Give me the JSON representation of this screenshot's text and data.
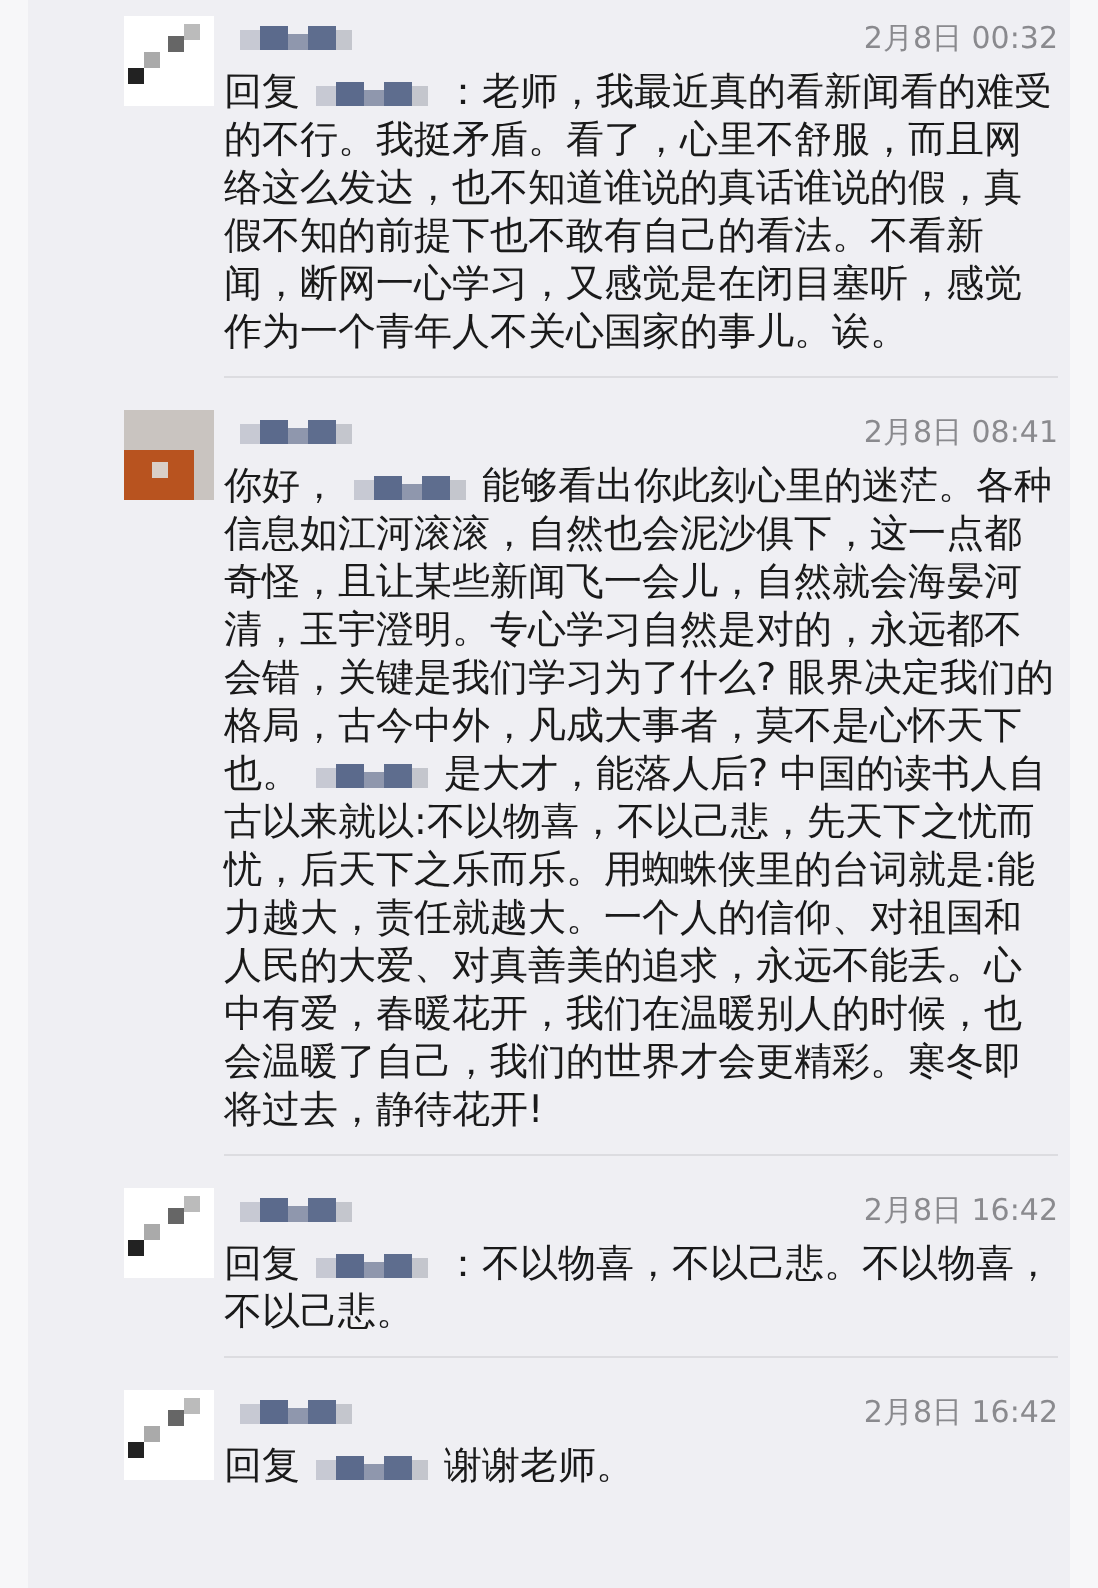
{
  "comments": [
    {
      "time": "2月8日 00:32",
      "avatar": {
        "kind": "plain"
      },
      "body": [
        {
          "kind": "text",
          "text": "回复"
        },
        {
          "kind": "redacted"
        },
        {
          "kind": "text",
          "text": "：老师，我最近真的看新闻看的难受的不行。我挺矛盾。看了，心里不舒服，而且网络这么发达，也不知道谁说的真话谁说的假，真假不知的前提下也不敢有自己的看法。不看新闻，断网一心学习，又感觉是在闭目塞听，感觉作为一个青年人不关心国家的事儿。诶。"
        }
      ]
    },
    {
      "time": "2月8日 08:41",
      "avatar": {
        "kind": "brown"
      },
      "body": [
        {
          "kind": "text",
          "text": "你好，"
        },
        {
          "kind": "redacted"
        },
        {
          "kind": "text",
          "text": "能够看出你此刻心里的迷茫。各种信息如江河滚滚，自然也会泥沙俱下，这一点都奇怪，且让某些新闻飞一会儿，自然就会海晏河清，玉宇澄明。专心学习自然是对的，永远都不会错，关键是我们学习为了什么? 眼界决定我们的格局，古今中外，凡成大事者，莫不是心怀天下也。"
        },
        {
          "kind": "redacted"
        },
        {
          "kind": "text",
          "text": "是大才，能落人后? 中国的读书人自古以来就以:不以物喜，不以己悲，先天下之忧而忧，后天下之乐而乐。用蜘蛛侠里的台词就是:能力越大，责任就越大。一个人的信仰、对祖国和人民的大爱、对真善美的追求，永远不能丢。心中有爱，春暖花开，我们在温暖别人的时候，也会温暖了自己，我们的世界才会更精彩。寒冬即将过去，静待花开!"
        }
      ]
    },
    {
      "time": "2月8日 16:42",
      "avatar": {
        "kind": "plain"
      },
      "body": [
        {
          "kind": "text",
          "text": "回复"
        },
        {
          "kind": "redacted"
        },
        {
          "kind": "text",
          "text": "：不以物喜，不以己悲。不以物喜，不以己悲。"
        }
      ]
    },
    {
      "time": "2月8日 16:42",
      "avatar": {
        "kind": "plain"
      },
      "body": [
        {
          "kind": "text",
          "text": "回复"
        },
        {
          "kind": "redacted"
        },
        {
          "kind": "text",
          "text": "谢谢老师。"
        }
      ]
    }
  ]
}
